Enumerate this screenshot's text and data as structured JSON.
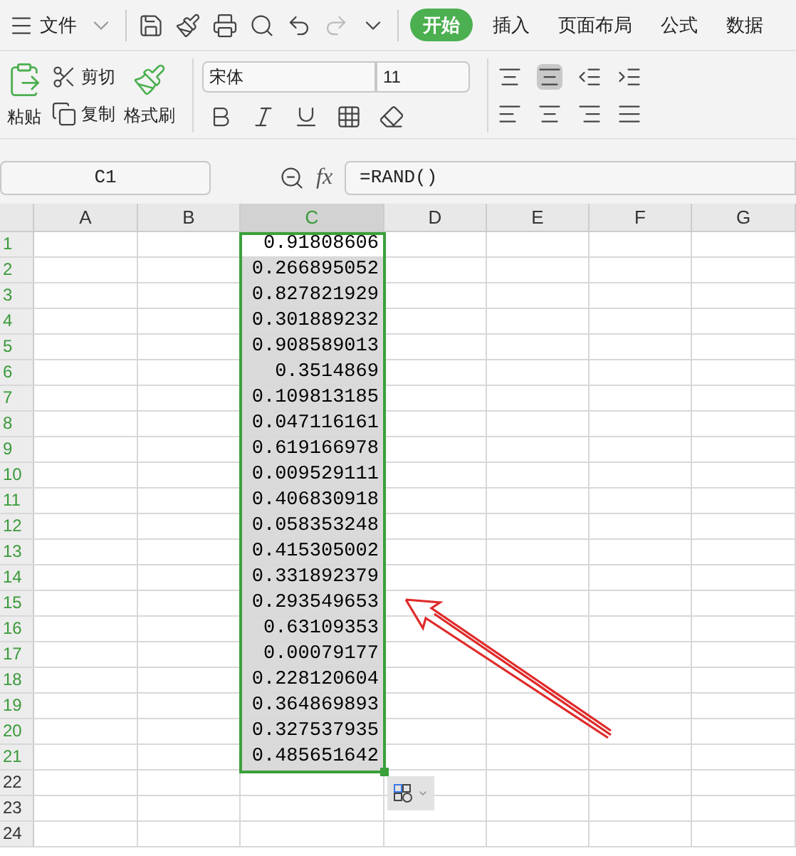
{
  "menu": {
    "file": "文件",
    "tabs": [
      {
        "label": "开始",
        "selected": true
      },
      {
        "label": "插入",
        "selected": false
      },
      {
        "label": "页面布局",
        "selected": false
      },
      {
        "label": "公式",
        "selected": false
      },
      {
        "label": "数据",
        "selected": false
      }
    ]
  },
  "ribbon": {
    "paste": "粘贴",
    "cut": "剪切",
    "copy": "复制",
    "format_painter": "格式刷",
    "font": "宋体",
    "size": "11"
  },
  "formula_bar": {
    "name_box": "C1",
    "function_label": "fx",
    "formula": "=RAND()"
  },
  "sheet": {
    "columns": [
      {
        "label": "A",
        "selected": false
      },
      {
        "label": "B",
        "selected": false
      },
      {
        "label": "C",
        "selected": true
      },
      {
        "label": "D",
        "selected": false
      },
      {
        "label": "E",
        "selected": false
      },
      {
        "label": "F",
        "selected": false
      },
      {
        "label": "G",
        "selected": false
      }
    ],
    "rows": [
      {
        "label": "1",
        "c": "0.91808606"
      },
      {
        "label": "2",
        "c": "0.266895052"
      },
      {
        "label": "3",
        "c": "0.827821929"
      },
      {
        "label": "4",
        "c": "0.301889232"
      },
      {
        "label": "5",
        "c": "0.908589013"
      },
      {
        "label": "6",
        "c": "0.3514869"
      },
      {
        "label": "7",
        "c": "0.109813185"
      },
      {
        "label": "8",
        "c": "0.047116161"
      },
      {
        "label": "9",
        "c": "0.619166978"
      },
      {
        "label": "10",
        "c": "0.009529111"
      },
      {
        "label": "11",
        "c": "0.406830918"
      },
      {
        "label": "12",
        "c": "0.058353248"
      },
      {
        "label": "13",
        "c": "0.415305002"
      },
      {
        "label": "14",
        "c": "0.331892379"
      },
      {
        "label": "15",
        "c": "0.293549653"
      },
      {
        "label": "16",
        "c": "0.63109353"
      },
      {
        "label": "17",
        "c": "0.00079177"
      },
      {
        "label": "18",
        "c": "0.228120604"
      },
      {
        "label": "19",
        "c": "0.364869893"
      },
      {
        "label": "20",
        "c": "0.327537935"
      },
      {
        "label": "21",
        "c": "0.485651642"
      },
      {
        "label": "22"
      },
      {
        "label": "23"
      },
      {
        "label": "24"
      }
    ]
  }
}
